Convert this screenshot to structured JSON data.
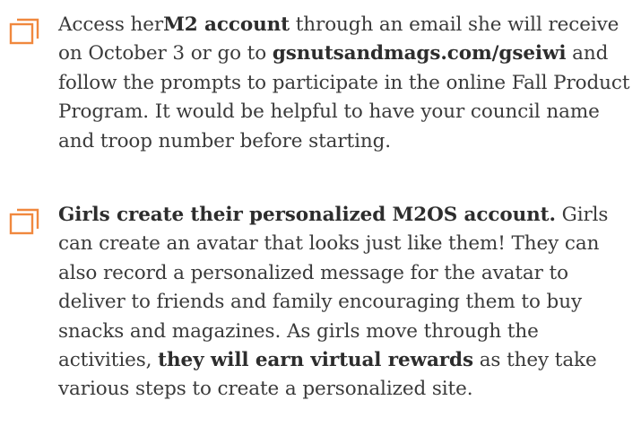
{
  "checklist": {
    "accent_color": "#f0883e",
    "items": [
      {
        "icon": "checkbox-icon",
        "segments": [
          {
            "text": "Access her",
            "bold": false
          },
          {
            "text": "M2 account",
            "bold": true
          },
          {
            "text": " through an email she will receive on October 3 or go to ",
            "bold": false
          },
          {
            "text": "gsnutsandmags.com/gseiwi",
            "bold": true
          },
          {
            "text": " and follow the prompts to participate in the online Fall Product Program.  It would be helpful to have your council name and troop number before starting.",
            "bold": false
          }
        ]
      },
      {
        "icon": "checkbox-icon",
        "segments": [
          {
            "text": "Girls create their personalized M2OS account.",
            "bold": true
          },
          {
            "text": " Girls can create an avatar that looks just like them! They can also record a personalized message for the avatar to deliver to friends and family encouraging them to buy snacks and magazines.  As girls move through the activities, ",
            "bold": false
          },
          {
            "text": "they will earn virtual rewards",
            "bold": true
          },
          {
            "text": " as they take various steps to create a personalized site.",
            "bold": false
          }
        ]
      }
    ]
  }
}
